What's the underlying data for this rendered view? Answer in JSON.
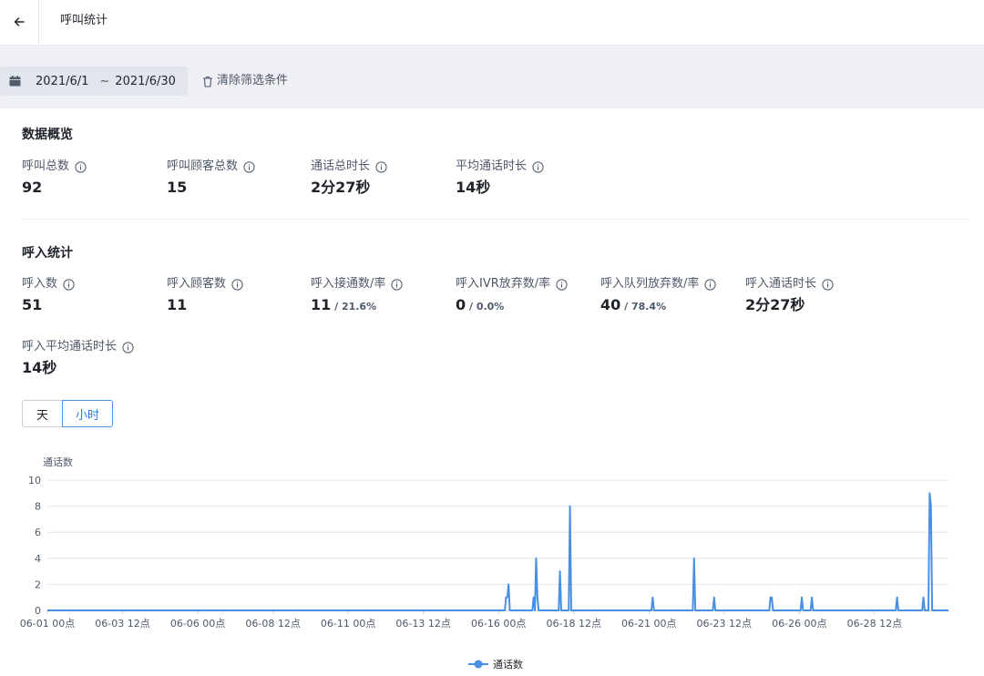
{
  "header": {
    "title": "呼叫统计"
  },
  "filter": {
    "start_date": "2021/6/1",
    "separator": "~",
    "end_date": "2021/6/30",
    "clear_label": "清除筛选条件"
  },
  "overview": {
    "title": "数据概览",
    "metrics": [
      {
        "label": "呼叫总数",
        "value": "92"
      },
      {
        "label": "呼叫顾客总数",
        "value": "15"
      },
      {
        "label": "通话总时长",
        "value": "2分27秒"
      },
      {
        "label": "平均通话时长",
        "value": "14秒"
      }
    ]
  },
  "inbound": {
    "title": "呼入统计",
    "metrics": [
      {
        "label": "呼入数",
        "value": "51",
        "ratio": ""
      },
      {
        "label": "呼入顾客数",
        "value": "11",
        "ratio": ""
      },
      {
        "label": "呼入接通数/率",
        "value": "11",
        "ratio": " / 21.6%"
      },
      {
        "label": "呼入IVR放弃数/率",
        "value": "0",
        "ratio": " / 0.0%"
      },
      {
        "label": "呼入队列放弃数/率",
        "value": "40",
        "ratio": " / 78.4%"
      },
      {
        "label": "呼入通话时长",
        "value": "2分27秒",
        "ratio": ""
      },
      {
        "label": "呼入平均通话时长",
        "value": "14秒",
        "ratio": ""
      }
    ]
  },
  "granularity": {
    "day_label": "天",
    "hour_label": "小时",
    "selected": "hour"
  },
  "colors": {
    "accent": "#2b7de9",
    "series": "#4a90e2"
  },
  "chart_data": {
    "type": "line",
    "ylabel": "通话数",
    "ylim": [
      0,
      10
    ],
    "yticks": [
      0,
      2,
      4,
      6,
      8,
      10
    ],
    "xlim": [
      0,
      719
    ],
    "x_unit": "hours since 06-01 00点",
    "xticks": [
      {
        "x": 0,
        "label": "06-01 00点"
      },
      {
        "x": 60,
        "label": "06-03 12点"
      },
      {
        "x": 120,
        "label": "06-06 00点"
      },
      {
        "x": 180,
        "label": "06-08 12点"
      },
      {
        "x": 240,
        "label": "06-11 00点"
      },
      {
        "x": 300,
        "label": "06-13 12点"
      },
      {
        "x": 360,
        "label": "06-16 00点"
      },
      {
        "x": 420,
        "label": "06-18 12点"
      },
      {
        "x": 480,
        "label": "06-21 00点"
      },
      {
        "x": 540,
        "label": "06-23 12点"
      },
      {
        "x": 600,
        "label": "06-26 00点"
      },
      {
        "x": 660,
        "label": "06-28 12点"
      }
    ],
    "legend": "bottom-center",
    "series": [
      {
        "name": "通话数",
        "points": [
          {
            "x": 366,
            "y": 1
          },
          {
            "x": 367,
            "y": 1
          },
          {
            "x": 368,
            "y": 2
          },
          {
            "x": 388,
            "y": 1
          },
          {
            "x": 390,
            "y": 4
          },
          {
            "x": 391,
            "y": 1
          },
          {
            "x": 409,
            "y": 3
          },
          {
            "x": 417,
            "y": 8
          },
          {
            "x": 483,
            "y": 1
          },
          {
            "x": 516,
            "y": 4
          },
          {
            "x": 532,
            "y": 1
          },
          {
            "x": 577,
            "y": 1
          },
          {
            "x": 578,
            "y": 1
          },
          {
            "x": 602,
            "y": 1
          },
          {
            "x": 610,
            "y": 1
          },
          {
            "x": 678,
            "y": 1
          },
          {
            "x": 699,
            "y": 1
          },
          {
            "x": 704,
            "y": 9
          },
          {
            "x": 705,
            "y": 8
          }
        ]
      }
    ]
  }
}
